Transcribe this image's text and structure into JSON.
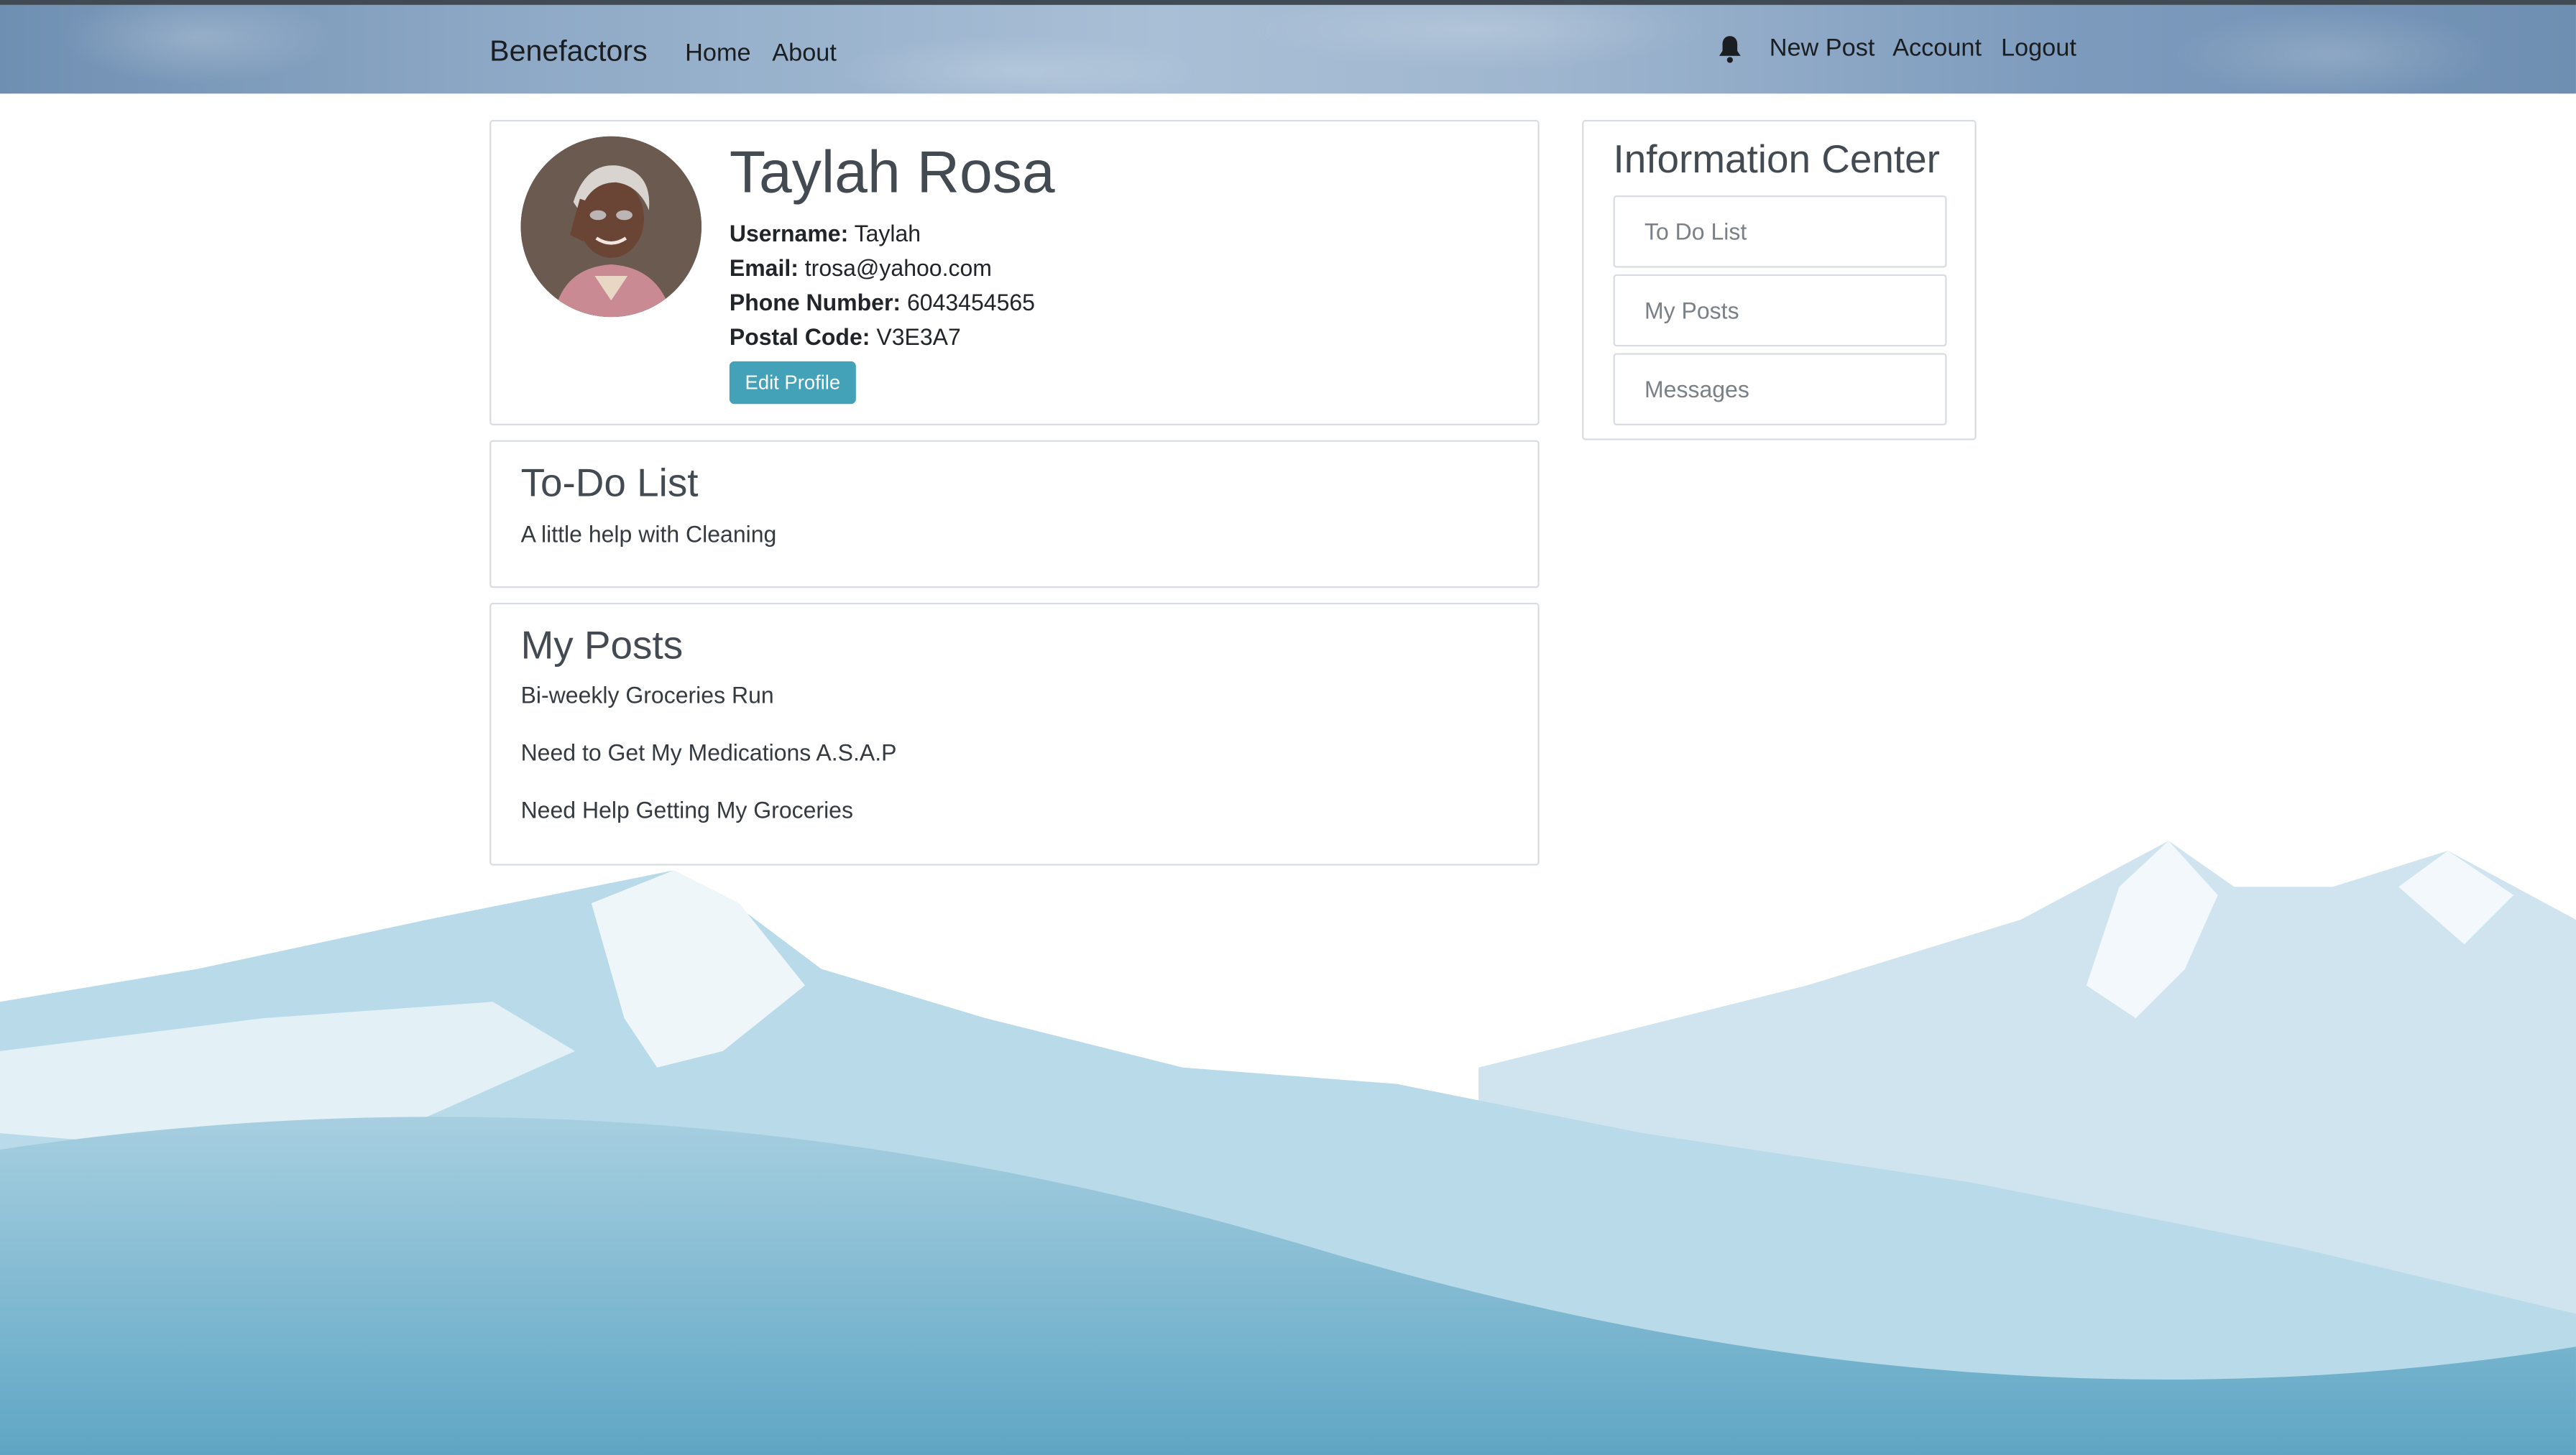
{
  "navbar": {
    "brand": "Benefactors",
    "links": [
      "Home",
      "About"
    ],
    "right_links": [
      "New Post",
      "Account",
      "Logout"
    ],
    "notification_icon": "bell-icon"
  },
  "profile": {
    "name": "Taylah Rosa",
    "username_label": "Username:",
    "username": "Taylah",
    "email_label": "Email:",
    "email": "trosa@yahoo.com",
    "phone_label": "Phone Number:",
    "phone": "6043454565",
    "postal_label": "Postal Code:",
    "postal": "V3E3A7",
    "edit_button": "Edit Profile"
  },
  "todo": {
    "title": "To-Do List",
    "items": [
      "A little help with Cleaning"
    ]
  },
  "posts": {
    "title": "My Posts",
    "items": [
      "Bi-weekly Groceries Run",
      "Need to Get My Medications A.S.A.P",
      "Need Help Getting My Groceries"
    ]
  },
  "info_center": {
    "title": "Information Center",
    "buttons": [
      "To Do List",
      "My Posts",
      "Messages"
    ]
  },
  "colors": {
    "accent": "#43a2b8",
    "mountain_blue": "#6aaecb"
  }
}
